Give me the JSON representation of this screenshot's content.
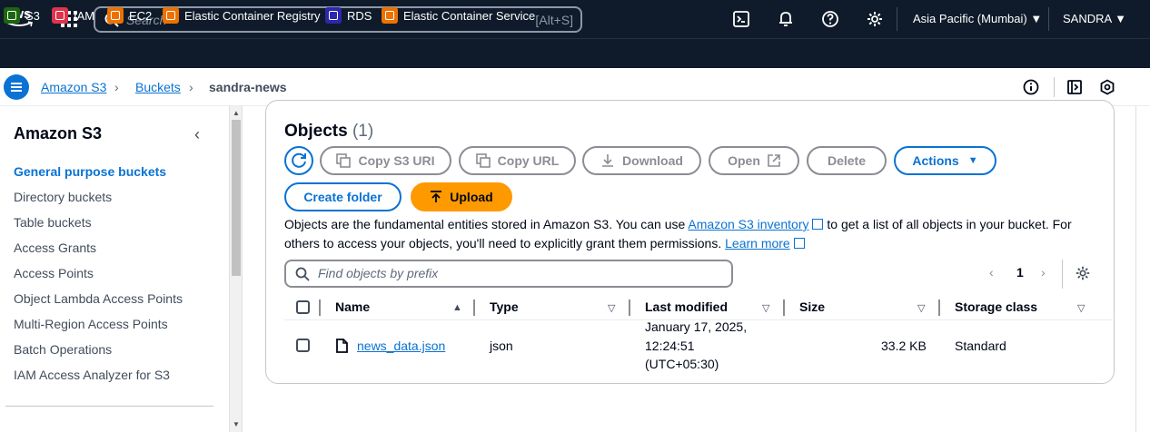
{
  "topbar": {
    "logo_text": "aws",
    "search_placeholder": "Search",
    "search_shortcut": "[Alt+S]",
    "region": "Asia Pacific (Mumbai)",
    "user": "SANDRA"
  },
  "favorites": [
    {
      "label": "S3",
      "color": "#1b660f"
    },
    {
      "label": "IAM",
      "color": "#dd344c"
    },
    {
      "label": "EC2",
      "color": "#ed7100"
    },
    {
      "label": "Elastic Container Registry",
      "color": "#ed7100"
    },
    {
      "label": "RDS",
      "color": "#2e27ad"
    },
    {
      "label": "Elastic Container Service",
      "color": "#ed7100"
    }
  ],
  "breadcrumb": {
    "items": [
      "Amazon S3",
      "Buckets"
    ],
    "current": "sandra-news"
  },
  "sidebar": {
    "title": "Amazon S3",
    "items": [
      "General purpose buckets",
      "Directory buckets",
      "Table buckets",
      "Access Grants",
      "Access Points",
      "Object Lambda Access Points",
      "Multi-Region Access Points",
      "Batch Operations",
      "IAM Access Analyzer for S3"
    ]
  },
  "objects": {
    "title": "Objects",
    "count": "(1)",
    "buttons": {
      "copy_s3_uri": "Copy S3 URI",
      "copy_url": "Copy URL",
      "download": "Download",
      "open": "Open",
      "delete": "Delete",
      "actions": "Actions",
      "create_folder": "Create folder",
      "upload": "Upload"
    },
    "description": {
      "part1": "Objects are the fundamental entities stored in Amazon S3. You can use ",
      "link1": "Amazon S3 inventory",
      "part2": " to get a list of all objects in your bucket. For others to access your objects, you'll need to explicitly grant them permissions. ",
      "link2": "Learn more"
    },
    "find_placeholder": "Find objects by prefix",
    "page": "1",
    "columns": [
      "Name",
      "Type",
      "Last modified",
      "Size",
      "Storage class"
    ],
    "rows": [
      {
        "name": "news_data.json",
        "type": "json",
        "modified_line1": "January 17, 2025,",
        "modified_line2": "12:24:51",
        "modified_line3": "(UTC+05:30)",
        "size": "33.2 KB",
        "storage_class": "Standard"
      }
    ]
  }
}
